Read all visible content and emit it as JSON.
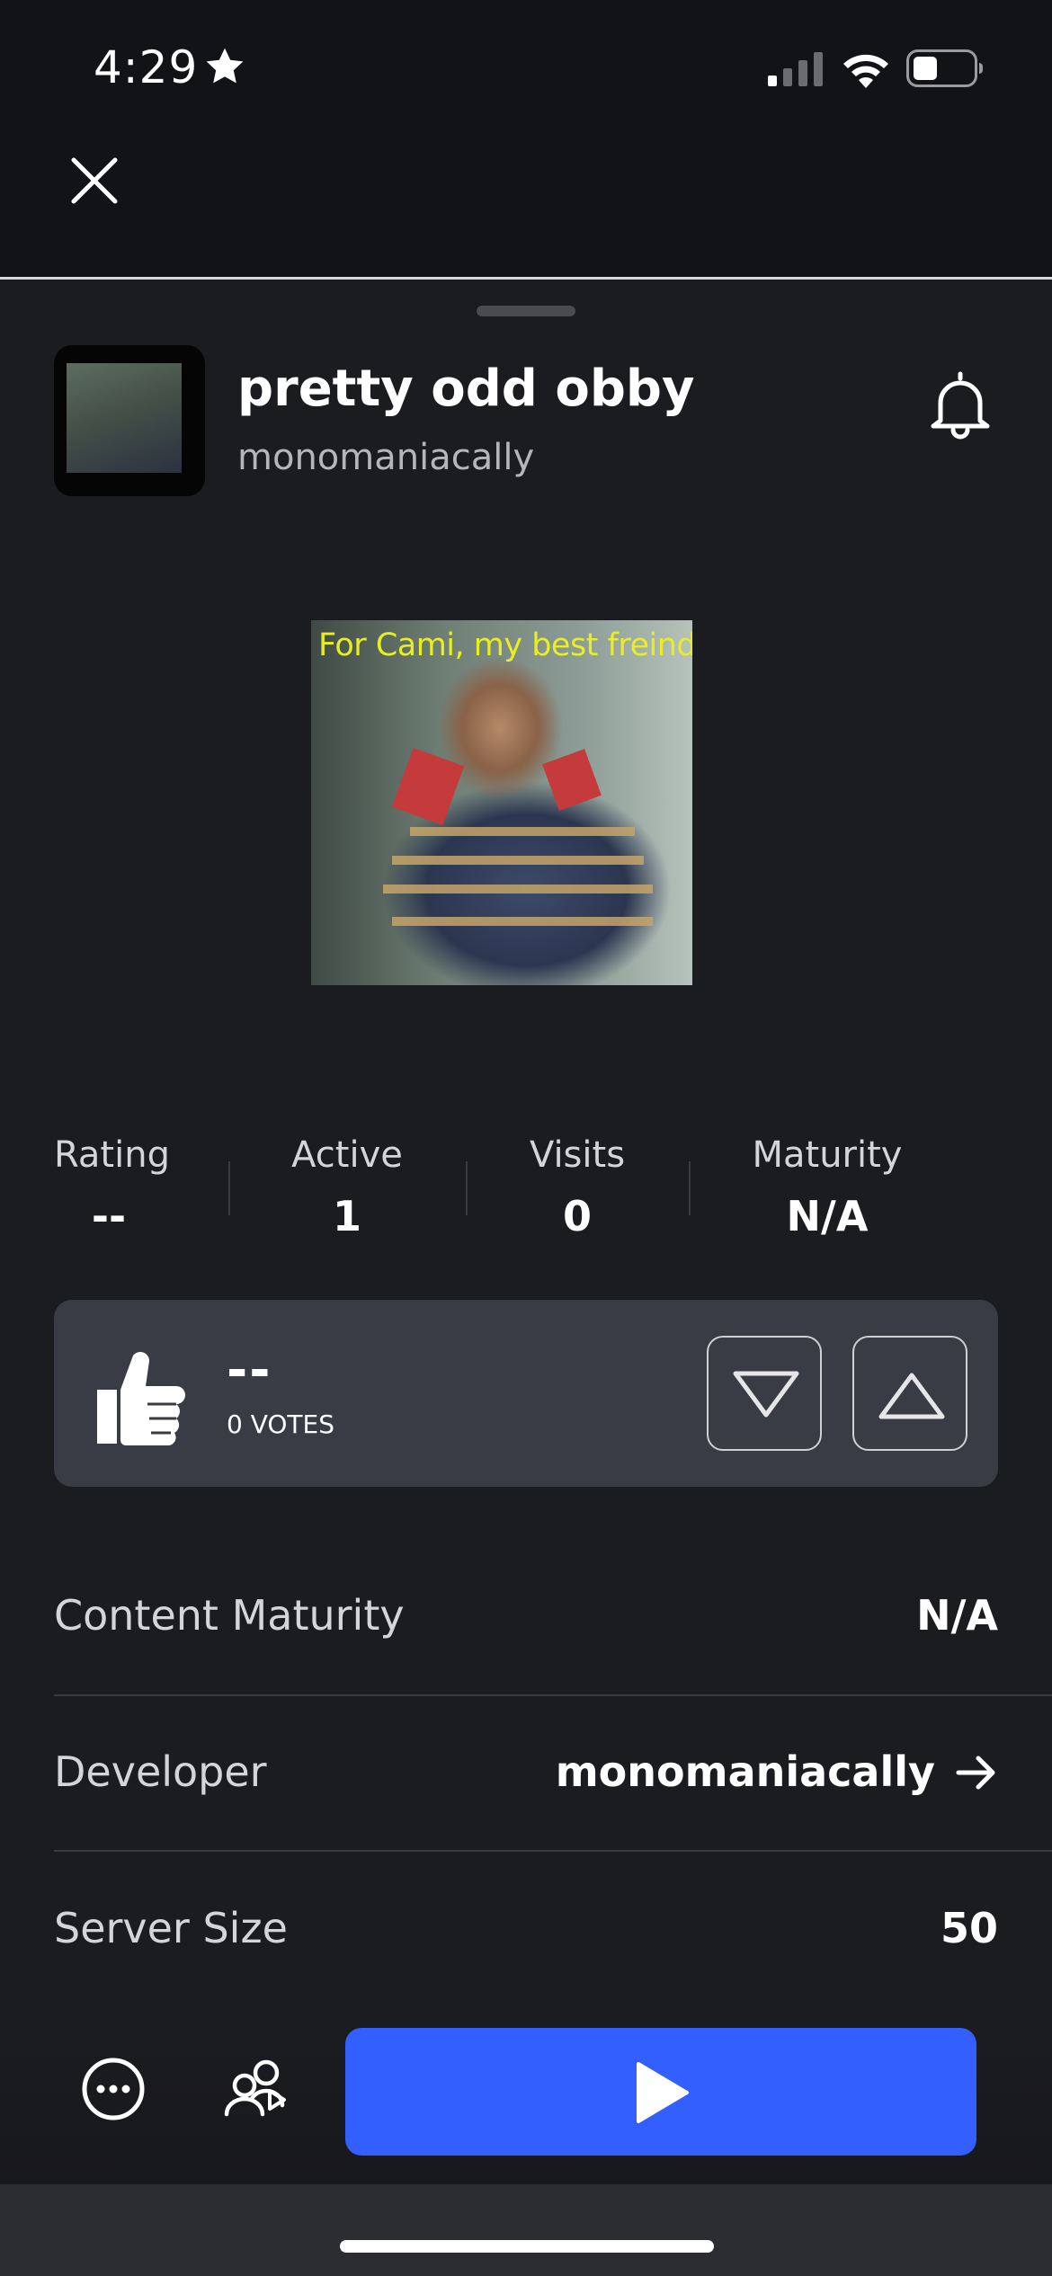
{
  "status_bar": {
    "time": "4:29",
    "icons": [
      "star-icon",
      "signal-icon",
      "wifi-icon",
      "battery-icon"
    ]
  },
  "nav": {
    "close_icon": "close-icon"
  },
  "game": {
    "title": "pretty odd obby",
    "developer": "monomaniacally",
    "thumbnail_caption": "For Cami, my best freind.",
    "notify_icon": "bell-icon"
  },
  "stats": [
    {
      "label": "Rating",
      "value": "--"
    },
    {
      "label": "Active",
      "value": "1"
    },
    {
      "label": "Visits",
      "value": "0"
    },
    {
      "label": "Maturity",
      "value": "N/A"
    }
  ],
  "votes": {
    "score": "--",
    "count_label": "0 VOTES",
    "icon": "thumbs-up-icon",
    "downvote_icon": "triangle-down-icon",
    "upvote_icon": "triangle-up-icon"
  },
  "details": [
    {
      "label": "Content Maturity",
      "value": "N/A"
    },
    {
      "label": "Developer",
      "value": "monomaniacally"
    },
    {
      "label": "Server Size",
      "value": "50"
    }
  ],
  "actions": {
    "more_icon": "more-icon",
    "party_icon": "party-icon",
    "play_icon": "play-icon"
  },
  "colors": {
    "background": "#1b1c20",
    "card": "#393b45",
    "play_button": "#335fff",
    "caption": "#e9ee22"
  }
}
